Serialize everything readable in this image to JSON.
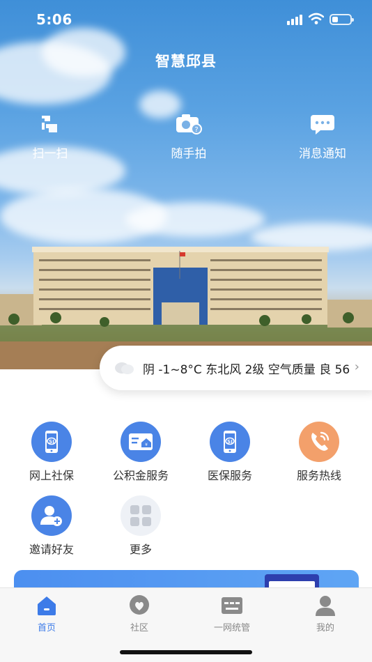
{
  "status": {
    "time": "5:06"
  },
  "app": {
    "title": "智慧邱县"
  },
  "quick_actions": [
    {
      "label": "扫一扫",
      "icon": "scan-icon"
    },
    {
      "label": "随手拍",
      "icon": "camera-icon"
    },
    {
      "label": "消息通知",
      "icon": "message-icon"
    }
  ],
  "weather": {
    "text": "阴 -1~8°C 东北风 2级 空气质量 良 56",
    "chevron": "›"
  },
  "services": [
    {
      "label": "网上社保",
      "icon": "social-security-phone-icon"
    },
    {
      "label": "公积金服务",
      "icon": "housing-fund-icon"
    },
    {
      "label": "医保服务",
      "icon": "medical-insurance-phone-icon"
    },
    {
      "label": "服务热线",
      "icon": "phone-hotline-icon"
    },
    {
      "label": "邀请好友",
      "icon": "invite-friend-icon"
    },
    {
      "label": "更多",
      "icon": "more-grid-icon"
    }
  ],
  "tabs": [
    {
      "label": "首页",
      "icon": "home-icon",
      "active": true
    },
    {
      "label": "社区",
      "icon": "community-icon",
      "active": false
    },
    {
      "label": "一网统管",
      "icon": "unified-management-icon",
      "active": false
    },
    {
      "label": "我的",
      "icon": "profile-icon",
      "active": false
    }
  ],
  "colors": {
    "accent": "#3d7be8",
    "service_blue": "#4a84e6",
    "hotline_orange": "#f3a06b"
  }
}
